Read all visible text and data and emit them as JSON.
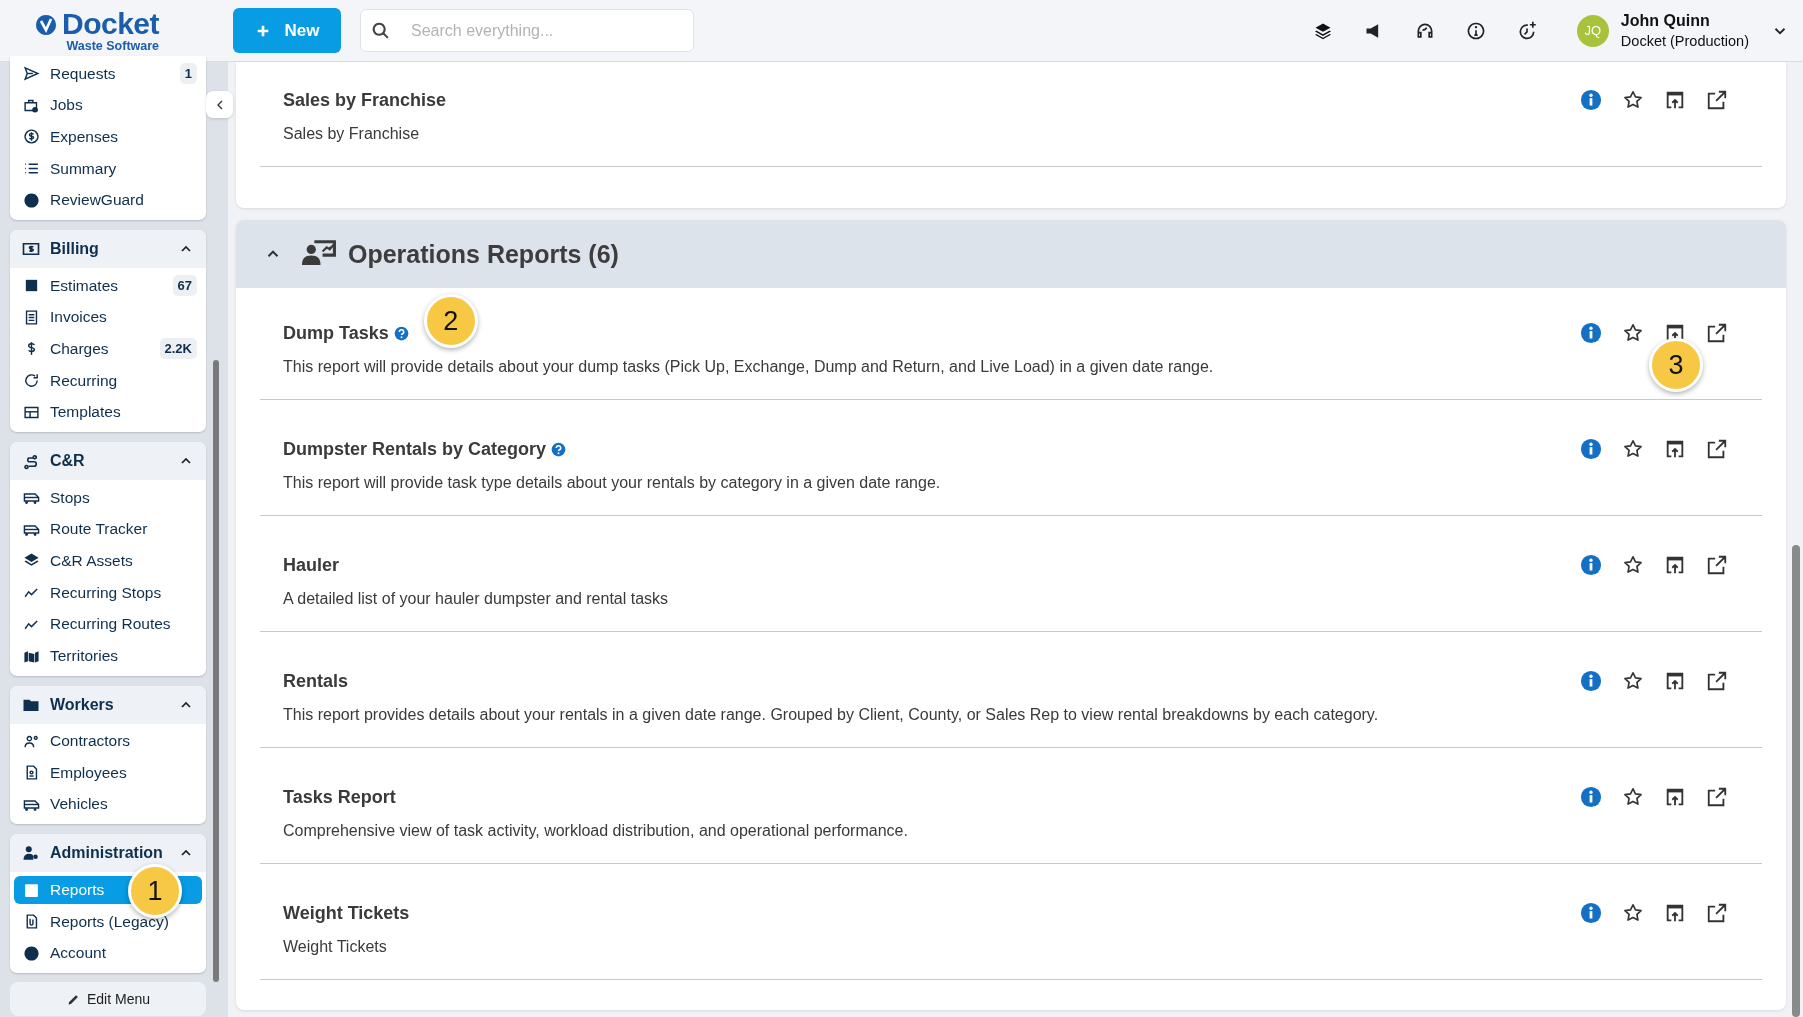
{
  "header": {
    "logo": {
      "name": "Docket",
      "tagline": "Waste Software"
    },
    "new_button": "New",
    "search": {
      "placeholder": "Search everything..."
    },
    "user": {
      "initials": "JQ",
      "name": "John Quinn",
      "account": "Docket (Production)"
    }
  },
  "sidebar": {
    "groups": [
      {
        "items": [
          {
            "label": "Requests",
            "count": "1",
            "selected": false
          },
          {
            "label": "Jobs",
            "selected": false
          },
          {
            "label": "Expenses",
            "selected": false
          },
          {
            "label": "Summary",
            "selected": false
          },
          {
            "label": "ReviewGuard",
            "selected": false
          }
        ]
      },
      {
        "title": "Billing",
        "expanded": true,
        "items": [
          {
            "label": "Estimates",
            "count": "67",
            "selected": false
          },
          {
            "label": "Invoices",
            "selected": false
          },
          {
            "label": "Charges",
            "count": "2.2K",
            "selected": false
          },
          {
            "label": "Recurring",
            "selected": false
          },
          {
            "label": "Templates",
            "selected": false
          }
        ]
      },
      {
        "title": "C&R",
        "expanded": true,
        "items": [
          {
            "label": "Stops",
            "selected": false
          },
          {
            "label": "Route Tracker",
            "selected": false
          },
          {
            "label": "C&R Assets",
            "selected": false
          },
          {
            "label": "Recurring Stops",
            "selected": false
          },
          {
            "label": "Recurring Routes",
            "selected": false
          },
          {
            "label": "Territories",
            "selected": false
          }
        ]
      },
      {
        "title": "Workers",
        "expanded": true,
        "items": [
          {
            "label": "Contractors",
            "selected": false
          },
          {
            "label": "Employees",
            "selected": false
          },
          {
            "label": "Vehicles",
            "selected": false
          }
        ]
      },
      {
        "title": "Administration",
        "expanded": true,
        "items": [
          {
            "label": "Reports",
            "selected": true,
            "callout": "1"
          },
          {
            "label": "Reports (Legacy)",
            "selected": false
          },
          {
            "label": "Account",
            "selected": false
          }
        ]
      }
    ],
    "edit_button": "Edit Menu"
  },
  "sections": [
    {
      "reports": [
        {
          "title": "Sales by Franchise",
          "description": "Sales by Franchise",
          "help": false
        }
      ]
    },
    {
      "title": "Operations Reports (6)",
      "expanded": true,
      "reports": [
        {
          "title": "Dump Tasks",
          "description": "This report will provide details about your dump tasks (Pick Up, Exchange, Dump and Return, and Live Load) in a given date range.",
          "help": true,
          "title_callout": "2",
          "actions_callout": "3"
        },
        {
          "title": "Dumpster Rentals by Category",
          "description": "This report will provide task type details about your rentals by category in a given date range.",
          "help": true
        },
        {
          "title": "Hauler",
          "description": "A detailed list of your hauler dumpster and rental tasks",
          "help": false
        },
        {
          "title": "Rentals",
          "description": "This report provides details about your rentals in a given date range. Grouped by Client, County, or Sales Rep to view rental breakdowns by each category.",
          "help": false
        },
        {
          "title": "Tasks Report",
          "description": "Comprehensive view of task activity, workload distribution, and operational performance.",
          "help": false
        },
        {
          "title": "Weight Tickets",
          "description": "Weight Tickets",
          "help": false
        }
      ]
    }
  ]
}
